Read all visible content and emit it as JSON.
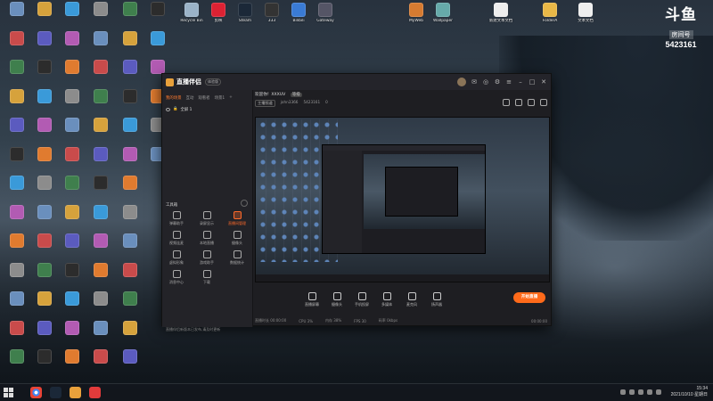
{
  "desktop_icons_left": [
    [
      "Recycle Bin",
      "#9bb3c8"
    ],
    [
      "剪映",
      "#d23"
    ],
    [
      "Steam",
      "#1b2838"
    ],
    [
      "333",
      "#333"
    ],
    [
      "Bilibili",
      "#3a7bd5"
    ],
    [
      "Gateway",
      "#556"
    ],
    [
      "MyWeb",
      "#d67b31"
    ],
    [
      "Wallpaper",
      "#6aa"
    ],
    [
      "新建文本文档",
      "#eee"
    ],
    [
      "FolderA",
      "#e9b847"
    ],
    [
      "文本文档",
      "#eee"
    ],
    [
      "回收站",
      "#ccc"
    ]
  ],
  "badge": {
    "logo": "斗鱼",
    "room_label": "房间号",
    "room_number": "5423161"
  },
  "app": {
    "name": "直播伴侣",
    "version": "体验版",
    "tabs": [
      "我的场景",
      "互动",
      "观看者",
      "场景1"
    ],
    "active_tab": "我的场景",
    "scene_name": "全屏 1",
    "toolbox_title": "工具箱",
    "tools": [
      {
        "label": "弹幕助手",
        "hot": false
      },
      {
        "label": "录屏显示",
        "hot": false
      },
      {
        "label": "直播间管理",
        "hot": true
      },
      {
        "label": "视频连麦",
        "hot": false
      },
      {
        "label": "本地直播",
        "hot": false
      },
      {
        "label": "摄像头",
        "hot": false
      },
      {
        "label": "虚拟形象",
        "hot": false
      },
      {
        "label": "游戏助手",
        "hot": false
      },
      {
        "label": "数据统计",
        "hot": false
      },
      {
        "label": "消息中心",
        "hot": false
      },
      {
        "label": "下载",
        "hot": false
      }
    ],
    "notice": "直播伴侣新版本已发布,请及时更新",
    "welcome": "欢迎你！XXXUV",
    "level": "等级",
    "sub": [
      "主播频道",
      "john3366",
      "5423161",
      "0"
    ],
    "controls": [
      "直播屏幕",
      "摄像头",
      "手机投屏",
      "多媒体",
      "麦克风",
      "扬声器"
    ],
    "live_button": "开始直播",
    "status": [
      "直播时长 00:00:00",
      "CPU 3%",
      "内存 38%",
      "FPS 30",
      "码率 0kbps"
    ],
    "status_right": "00:00:00"
  },
  "taskbar": {
    "time": "15:34",
    "date": "2021/10/10 星期日"
  }
}
